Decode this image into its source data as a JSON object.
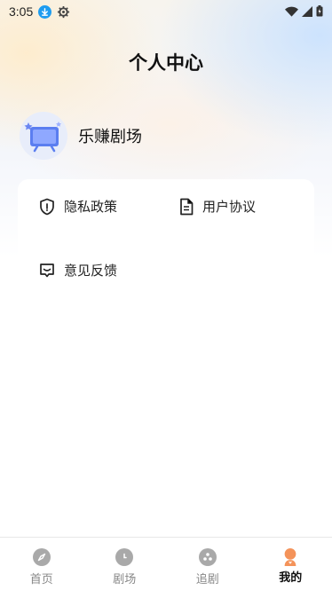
{
  "status_bar": {
    "time": "3:05"
  },
  "header": {
    "title": "个人中心"
  },
  "profile": {
    "name": "乐赚剧场"
  },
  "menu": {
    "privacy_label": "隐私政策",
    "agreement_label": "用户协议",
    "feedback_label": "意见反馈"
  },
  "tabbar": {
    "items": [
      {
        "label": "首页",
        "icon": "compass-icon"
      },
      {
        "label": "剧场",
        "icon": "clock-icon"
      },
      {
        "label": "追剧",
        "icon": "film-reel-icon"
      },
      {
        "label": "我的",
        "icon": "user-icon",
        "active": true
      }
    ]
  },
  "colors": {
    "accent_orange": "#f4935a",
    "download_blue": "#1e9cf0",
    "inactive_gray": "#a9a9a9"
  }
}
